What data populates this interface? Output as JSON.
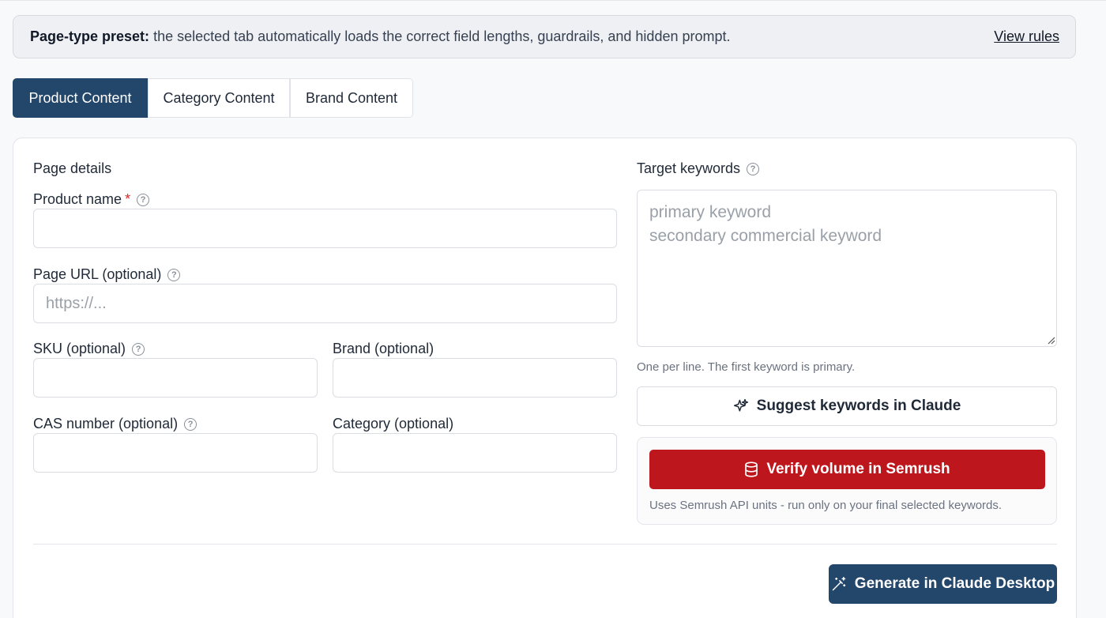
{
  "banner": {
    "prefix": "Page-type preset:",
    "text": "the selected tab automatically loads the correct field lengths, guardrails, and hidden prompt.",
    "link": "View rules"
  },
  "tabs": [
    {
      "label": "Product Content",
      "active": true
    },
    {
      "label": "Category Content",
      "active": false
    },
    {
      "label": "Brand Content",
      "active": false
    }
  ],
  "form": {
    "section_title": "Page details",
    "product_name": {
      "label": "Product name",
      "required_mark": "*",
      "value": "",
      "placeholder": ""
    },
    "page_url": {
      "label": "Page URL (optional)",
      "value": "",
      "placeholder": "https://..."
    },
    "sku": {
      "label": "SKU (optional)",
      "value": ""
    },
    "brand": {
      "label": "Brand (optional)",
      "value": ""
    },
    "cas": {
      "label": "CAS number (optional)",
      "value": ""
    },
    "category": {
      "label": "Category (optional)",
      "value": ""
    }
  },
  "keywords": {
    "label": "Target keywords",
    "placeholder": "primary keyword\nsecondary commercial keyword",
    "hint": "One per line. The first keyword is primary.",
    "suggest_button": "Suggest keywords in Claude",
    "verify_button": "Verify volume in Semrush",
    "verify_hint": "Uses Semrush API units - run only on your final selected keywords."
  },
  "generate_button": "Generate in Claude Desktop",
  "colors": {
    "primary": "#23466b",
    "semrush_red": "#be161d",
    "required": "#dc2626"
  },
  "icons": [
    "help-icon",
    "sparkle-icon",
    "database-icon",
    "magic-wand-icon",
    "resize-grip-icon"
  ]
}
